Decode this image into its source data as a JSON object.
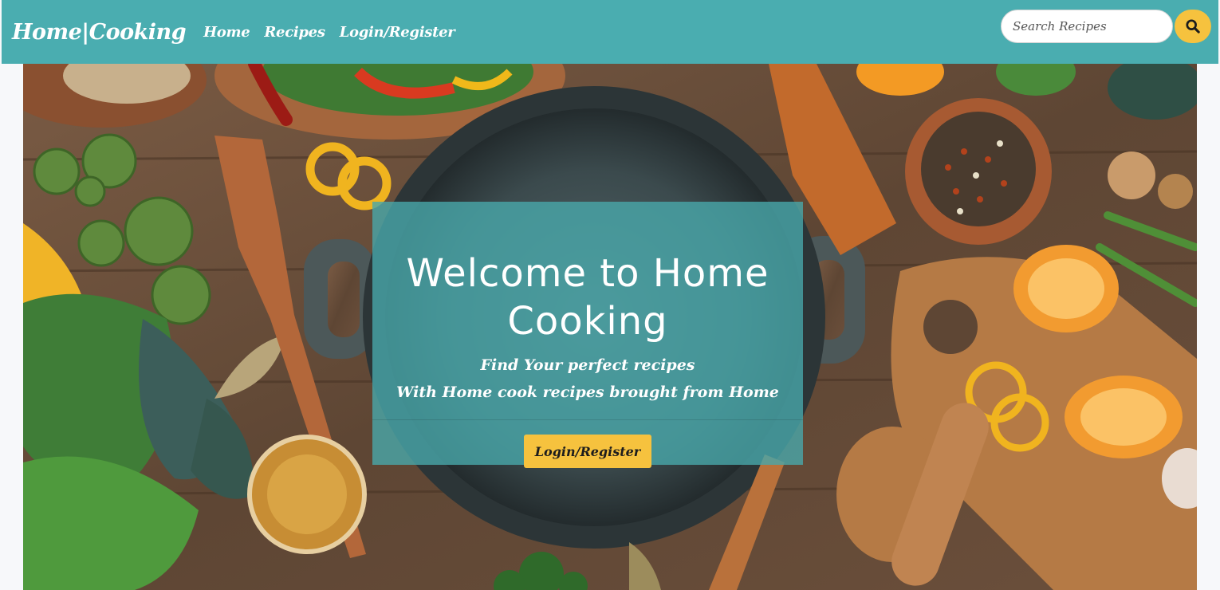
{
  "navbar": {
    "brand": "Home|Cooking",
    "links": [
      "Home",
      "Recipes",
      "Login/Register"
    ],
    "search": {
      "placeholder": "Search Recipes",
      "value": ""
    }
  },
  "hero": {
    "title": "Welcome to Home Cooking",
    "subtitle_line1": "Find Your perfect recipes",
    "subtitle_line2": "With Home cook recipes brought from Home",
    "cta_label": "Login/Register"
  },
  "colors": {
    "nav_background": "#4aadb0",
    "accent_yellow": "#f6c23e",
    "overlay_teal": "#48a8aa",
    "text_light": "#ffffff"
  },
  "icons": {
    "search_button": "search-icon"
  }
}
